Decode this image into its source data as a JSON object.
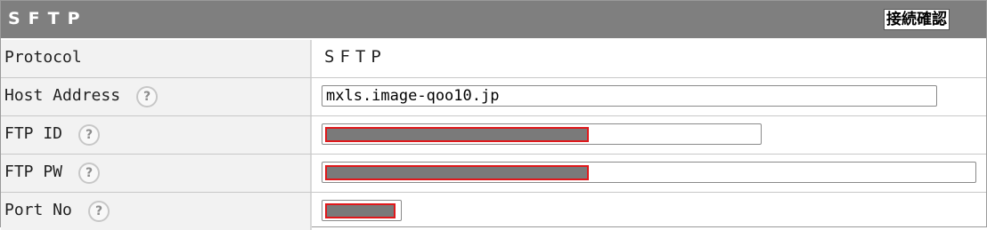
{
  "header": {
    "title": "SFTP",
    "check_button_label": "接続確認"
  },
  "rows": {
    "protocol": {
      "label": "Protocol",
      "value": "SFTP"
    },
    "host": {
      "label": "Host Address",
      "help": "?",
      "value": "mxls.image-qoo10.jp"
    },
    "ftp_id": {
      "label": "FTP ID",
      "help": "?",
      "value_redacted": true
    },
    "ftp_pw": {
      "label": "FTP PW",
      "help": "?",
      "value_redacted": true
    },
    "port": {
      "label": "Port No",
      "help": "?",
      "value_redacted": true
    }
  },
  "colors": {
    "header_bg": "#7f7f7f",
    "label_bg": "#f2f2f2",
    "redaction_fill": "#7a7a7a",
    "redaction_border": "#e0181b"
  }
}
